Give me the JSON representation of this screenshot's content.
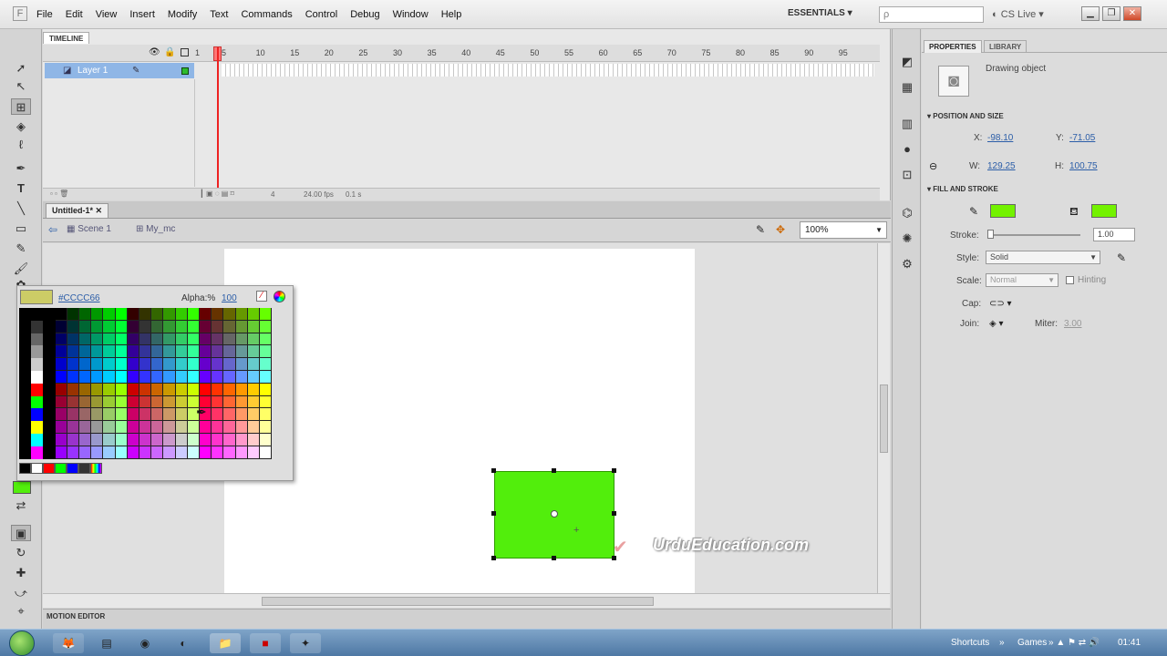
{
  "app": {
    "logo_letter": "F"
  },
  "menu": {
    "items": [
      "File",
      "Edit",
      "View",
      "Insert",
      "Modify",
      "Text",
      "Commands",
      "Control",
      "Debug",
      "Window",
      "Help"
    ],
    "workspace": "ESSENTIALS ▾",
    "search_placeholder": "ρ",
    "cslive": "CS Live"
  },
  "timeline": {
    "tab": "TIMELINE",
    "layer_name": "Layer 1",
    "ruler": [
      "1",
      "5",
      "10",
      "15",
      "20",
      "25",
      "30",
      "35",
      "40",
      "45",
      "50",
      "55",
      "60",
      "65",
      "70",
      "75",
      "80",
      "85",
      "90",
      "95"
    ],
    "frame": "4",
    "fps": "24.00 fps",
    "time": "0.1 s"
  },
  "document": {
    "tab": "Untitled-1*",
    "close": "✕",
    "scene": "Scene 1",
    "symbol": "My_mc",
    "zoom": "100%"
  },
  "motion_editor": "MOTION EDITOR",
  "watermark": "UrduEducation.com",
  "picker": {
    "hex": "#CCCC66",
    "alpha_label": "Alpha:%",
    "alpha": "100"
  },
  "properties": {
    "tab_properties": "PROPERTIES",
    "tab_library": "LIBRARY",
    "type": "Drawing object",
    "sec_pos": "POSITION AND SIZE",
    "x_label": "X:",
    "x": "-98.10",
    "y_label": "Y:",
    "y": "-71.05",
    "w_label": "W:",
    "w": "129.25",
    "h_label": "H:",
    "h": "100.75",
    "sec_fill": "FILL AND STROKE",
    "stroke_label": "Stroke:",
    "stroke": "1.00",
    "style_label": "Style:",
    "style": "Solid",
    "scale_label": "Scale:",
    "scale": "Normal",
    "hinting": "Hinting",
    "cap_label": "Cap:",
    "join_label": "Join:",
    "miter_label": "Miter:",
    "miter": "3.00",
    "fill_color": "#73f200",
    "stroke_color": "#73f200"
  },
  "taskbar": {
    "shortcuts": "Shortcuts",
    "games": "Games",
    "clock": "01:41"
  }
}
